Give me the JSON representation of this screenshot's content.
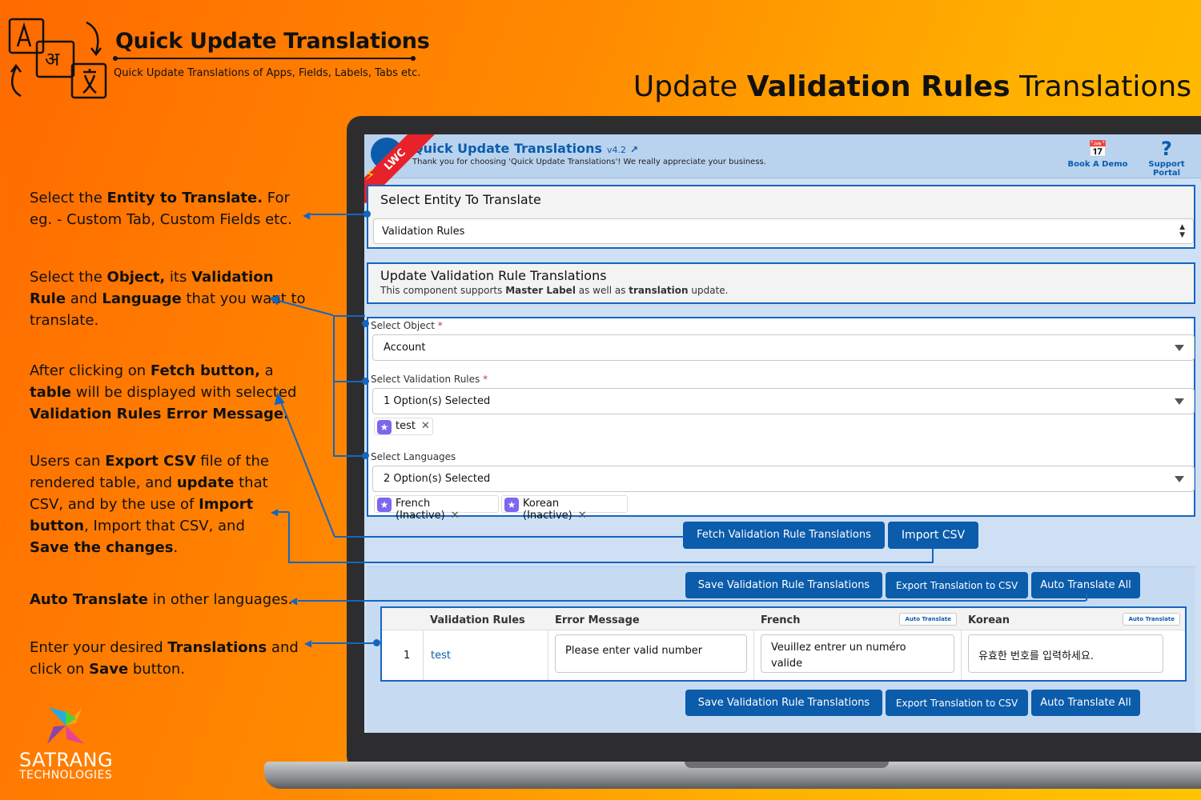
{
  "brand": {
    "title": "Quick Update Translations",
    "subtitle": "Quick Update Translations of Apps, Fields, Labels, Tabs etc.",
    "logo_name": "SATRANG",
    "logo_sub": "TECHNOLOGIES"
  },
  "headline": {
    "pre": "Update ",
    "bold": "Validation Rules",
    "post": " Translations"
  },
  "notes": {
    "n1": {
      "a": "Select the ",
      "b": "Entity to Translate.",
      "c": " For eg. - Custom Tab, Custom Fields etc."
    },
    "n2": {
      "a": "Select the ",
      "b": "Object,",
      "c": " its ",
      "d": "Validation Rule",
      "e": " and ",
      "f": "Language",
      "g": " that you want to translate."
    },
    "n3": {
      "a": "After clicking on ",
      "b": "Fetch button,",
      "c": " a ",
      "d": "table",
      "e": " will be displayed with selected ",
      "f": "Validation Rules Error Message."
    },
    "n4": {
      "a": "Users can ",
      "b": "Export CSV",
      "c": " file of the rendered table, and ",
      "d": "update",
      "e": " that CSV, and by the use of ",
      "f": "Import button",
      "g": ", Import that CSV, and ",
      "h": "Save the changes",
      "i": "."
    },
    "n5": {
      "a": "Auto Translate",
      "b": " in other languages."
    },
    "n6": {
      "a": "Enter your desired ",
      "b": "Translations",
      "c": " and click on ",
      "d": "Save",
      "e": " button."
    }
  },
  "app": {
    "title": "Quick Update Translations",
    "version": "v4.2",
    "thanks": "Thank you for choosing 'Quick Update Translations'! We really appreciate your business.",
    "ribbon": "LWC",
    "book_demo": "Book A Demo",
    "support": "Support Portal"
  },
  "entity": {
    "title": "Select Entity To Translate",
    "value": "Validation Rules"
  },
  "update": {
    "title": "Update Validation Rule Translations",
    "desc_a": "This component supports ",
    "desc_b": "Master Label",
    "desc_c": " as well as ",
    "desc_d": "translation",
    "desc_e": " update."
  },
  "form": {
    "object_label": "Select Object",
    "object_value": "Account",
    "rules_label": "Select Validation Rules",
    "rules_value": "1 Option(s) Selected",
    "rules_pills": [
      "test"
    ],
    "lang_label": "Select Languages",
    "lang_value": "2 Option(s) Selected",
    "lang_pills": [
      "French (Inactive)",
      "Korean (Inactive)"
    ],
    "required_mark": "*"
  },
  "buttons": {
    "fetch": "Fetch Validation Rule Translations",
    "import": "Import CSV",
    "save": "Save Validation Rule Translations",
    "export": "Export Translation to CSV",
    "auto_all": "Auto Translate All",
    "auto": "Auto Translate"
  },
  "table": {
    "headers": [
      "Validation Rules",
      "Error Message",
      "French",
      "Korean"
    ],
    "rows": [
      {
        "index": "1",
        "rule": "test",
        "error": "Please enter valid number",
        "french": "Veuillez entrer un numéro valide",
        "korean": "유효한 번호를 입력하세요."
      }
    ]
  },
  "colors": {
    "accent": "#0b5cab",
    "border": "#1565c0",
    "ribbon": "#e8222a"
  }
}
